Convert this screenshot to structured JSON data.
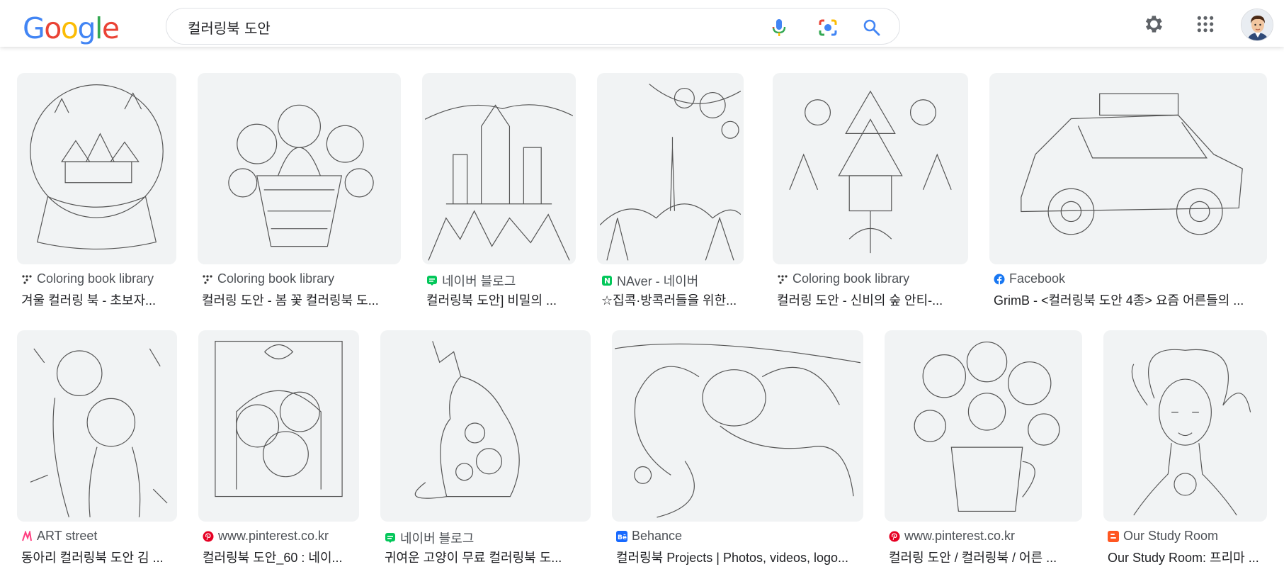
{
  "logo": {
    "letters": [
      "G",
      "o",
      "o",
      "g",
      "l",
      "e"
    ]
  },
  "search": {
    "query": "컬러링북 도안"
  },
  "icons": {
    "mic": "microphone-icon",
    "lens": "camera-lens-icon",
    "search": "search-icon",
    "settings": "gear-icon",
    "apps": "apps-grid-icon",
    "avatar": "user-avatar"
  },
  "colors": {
    "brand_blue": "#4285F4",
    "brand_red": "#EA4335",
    "brand_yellow": "#FBBC05",
    "brand_green": "#34A853"
  },
  "results": [
    {
      "source": "Coloring book library",
      "title": "겨울 컬러링 북 - 초보자...",
      "favicon": "coloring-library-icon",
      "thumb": "snow-globe-drawing"
    },
    {
      "source": "Coloring book library",
      "title": "컬러링 도안 - 봄 꽃 컬러링북 도...",
      "favicon": "coloring-library-icon",
      "thumb": "flower-basket-drawing"
    },
    {
      "source": "네이버 블로그",
      "title": "컬러링북 도안] 비밀의 ...",
      "favicon": "naver-blog-icon",
      "thumb": "castle-drawing"
    },
    {
      "source": "NAver - 네이버",
      "title": "☆집콕·방콕러들을 위한...",
      "favicon": "naver-icon",
      "thumb": "tower-landscape-drawing"
    },
    {
      "source": "Coloring book library",
      "title": "컬러링 도안 - 신비의 숲 안티-...",
      "favicon": "coloring-library-icon",
      "thumb": "mystic-forest-drawing"
    },
    {
      "source": "Facebook",
      "title": "GrimB - <컬러링북 도안 4종> 요즘 어른들의 ...",
      "favicon": "facebook-icon",
      "thumb": "car-drawing"
    },
    {
      "source": "ART street",
      "title": "동아리 컬러링북 도안 김 ...",
      "favicon": "art-street-icon",
      "thumb": "anime-girls-drawing"
    },
    {
      "source": "www.pinterest.co.kr",
      "title": "컬러링북 도안_60 : 네이...",
      "favicon": "pinterest-icon",
      "thumb": "kittens-drawing"
    },
    {
      "source": "네이버 블로그",
      "title": "귀여운 고양이 무료 컬러링북 도...",
      "favicon": "naver-blog-icon",
      "thumb": "patterned-cat-drawing"
    },
    {
      "source": "Behance",
      "title": "컬러링북 Projects | Photos, videos, logo...",
      "favicon": "behance-icon",
      "thumb": "sleeping-girl-drawing"
    },
    {
      "source": "www.pinterest.co.kr",
      "title": "컬러링 도안 / 컬러링북 / 어른 ...",
      "favicon": "pinterest-icon",
      "thumb": "flower-mug-drawing"
    },
    {
      "source": "Our Study Room",
      "title": "Our Study Room: 프리마 ...",
      "favicon": "blogger-icon",
      "thumb": "woman-portrait-drawing"
    }
  ]
}
